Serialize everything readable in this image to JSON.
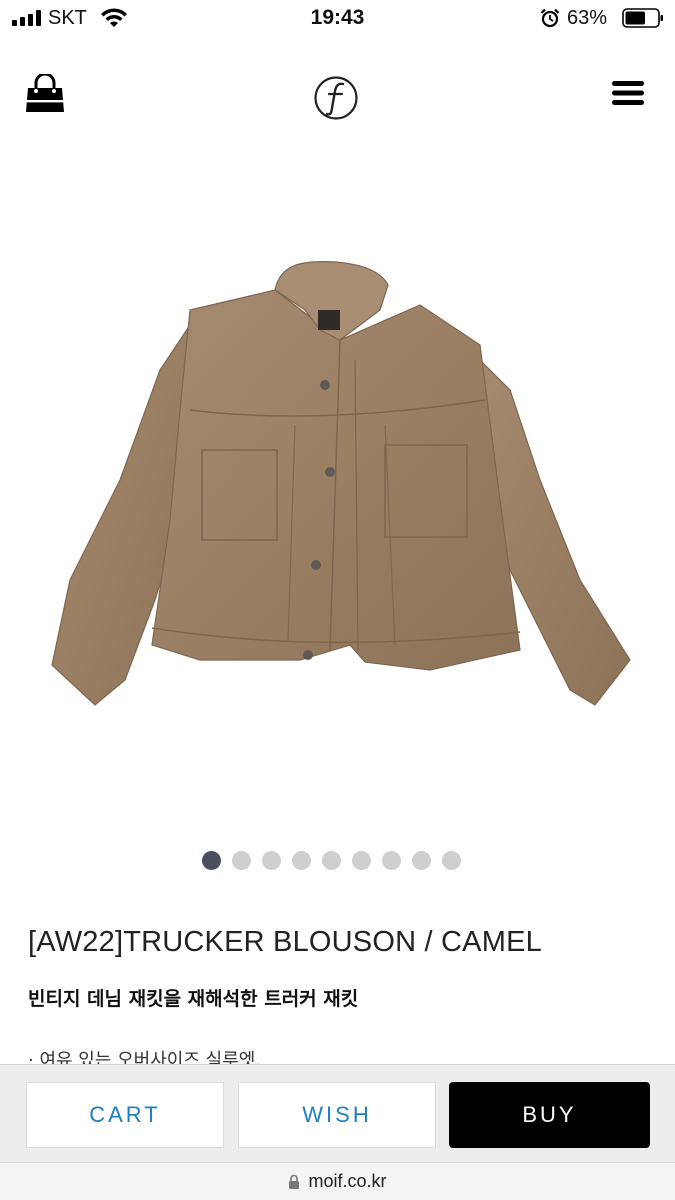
{
  "status_bar": {
    "carrier": "SKT",
    "time": "19:43",
    "battery": "63%",
    "battery_level": 0.63,
    "signal_bars": 4
  },
  "header": {
    "left_icon": "shopping-bag-icon",
    "logo_icon": "f-circle-logo",
    "right_icon": "hamburger-menu-icon"
  },
  "product": {
    "image": "camel-trucker-jacket",
    "image_count": 9,
    "active_image": 1,
    "title": "[AW22]TRUCKER BLOUSON / CAMEL",
    "subtitle": "빈티지 데님 재킷을 재해석한 트러커 재킷",
    "note": "· 여유 있는 오버사이즈 실루엣."
  },
  "actions": {
    "cart_label": "CART",
    "wish_label": "WISH",
    "buy_label": "BUY",
    "accent_color": "#1e7fc1"
  },
  "browser": {
    "url": "moif.co.kr",
    "lock_icon": "lock-icon"
  }
}
